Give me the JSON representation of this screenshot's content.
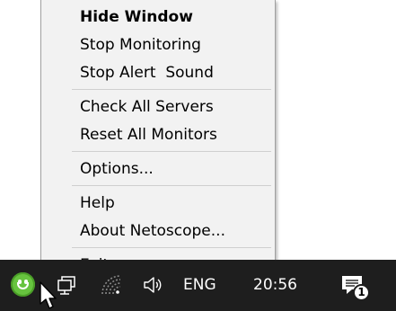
{
  "context_menu": {
    "items": [
      {
        "label": "Hide Window",
        "bold": true
      },
      {
        "label": "Stop Monitoring"
      },
      {
        "label": "Stop Alert  Sound"
      },
      {
        "label": "Check All Servers"
      },
      {
        "label": "Reset All Monitors"
      },
      {
        "label": "Options..."
      },
      {
        "label": "Help"
      },
      {
        "label": "About Netoscope..."
      },
      {
        "label": "Exit"
      }
    ]
  },
  "taskbar": {
    "tray_app_icon": "smiley-icon",
    "language": "ENG",
    "clock": "20:56",
    "notifications_count": "1",
    "icons": [
      "smiley-icon",
      "network-adapter-icon",
      "wifi-icon",
      "volume-icon",
      "action-center-icon"
    ]
  },
  "colors": {
    "menu_background": "#f2f2f2",
    "taskbar_background": "#1e1e1e",
    "app_icon_green": "#67c43f"
  }
}
